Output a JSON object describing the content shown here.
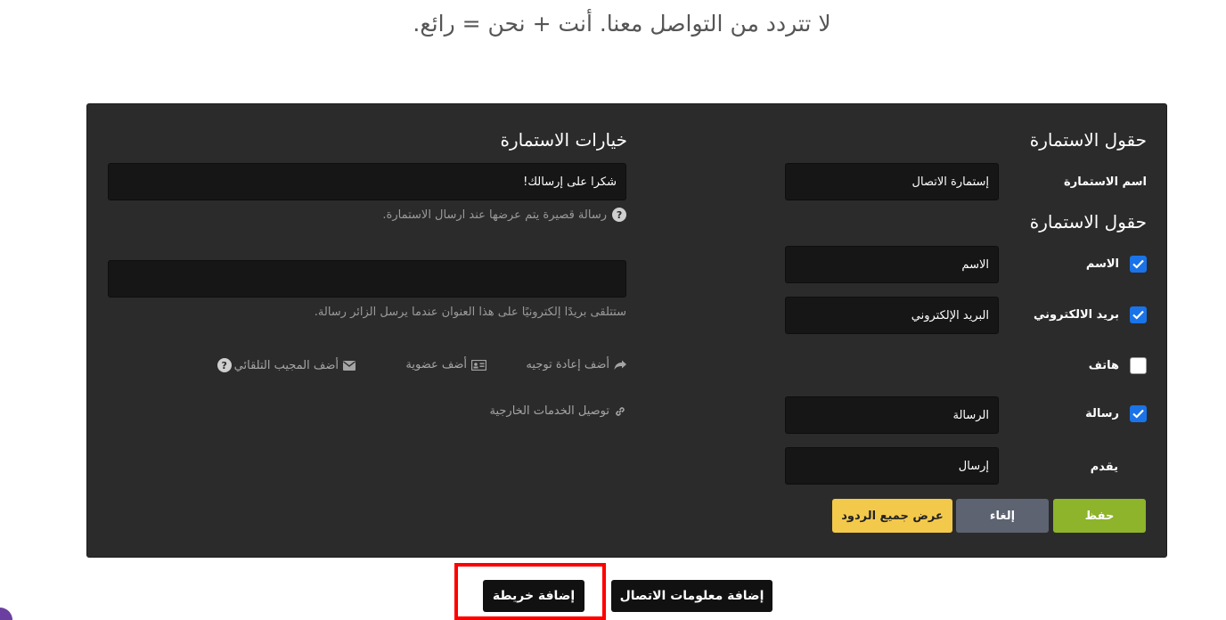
{
  "headline": "لا تتردد من التواصل معنا. أنت + نحن = رائع.",
  "form_fields": {
    "title": "حقول الاستمارة",
    "form_name_label": "اسم الاستمارة",
    "form_name_value": "إستمارة الاتصال",
    "fields_title": "حقول الاستمارة",
    "fields": [
      {
        "label": "الاسم",
        "checked": true,
        "value": "الاسم"
      },
      {
        "label": "بريد الالكتروني",
        "checked": true,
        "value": "البريد الإلكتروني"
      },
      {
        "label": "هاتف",
        "checked": false,
        "value": ""
      },
      {
        "label": "رسالة",
        "checked": true,
        "value": "الرسالة"
      }
    ],
    "submit_label": "يقدم",
    "submit_value": "إرسال"
  },
  "form_options": {
    "title": "خيارات الاستمارة",
    "thank_you_value": "شكرا على إرسالك!",
    "thank_you_hint": "رسالة قصيرة يتم عرضها عند ارسال الاستمارة.",
    "email_value": "",
    "email_hint": "ستتلقى بريدًا إلكترونيًا على هذا العنوان عندما يرسل الزائر رسالة.",
    "add_redirect": "أضف إعادة توجيه",
    "add_membership": "أضف عضوية",
    "add_autoresponder": "أضف المجيب التلقائي",
    "connect_services": "توصيل الخدمات الخارجية"
  },
  "buttons": {
    "save": "حفظ",
    "cancel": "إلغاء",
    "show_responses": "عرض جميع الردود"
  },
  "bottom": {
    "add_contact_info": "إضافة معلومات الاتصال",
    "add_map": "إضافة خريطة"
  },
  "colors": {
    "panel_bg": "#2b2b2b",
    "save": "#8db42b",
    "cancel": "#5d6370",
    "responses": "#f3c94b",
    "checkbox": "#1a73e8",
    "highlight": "#ff0000"
  }
}
